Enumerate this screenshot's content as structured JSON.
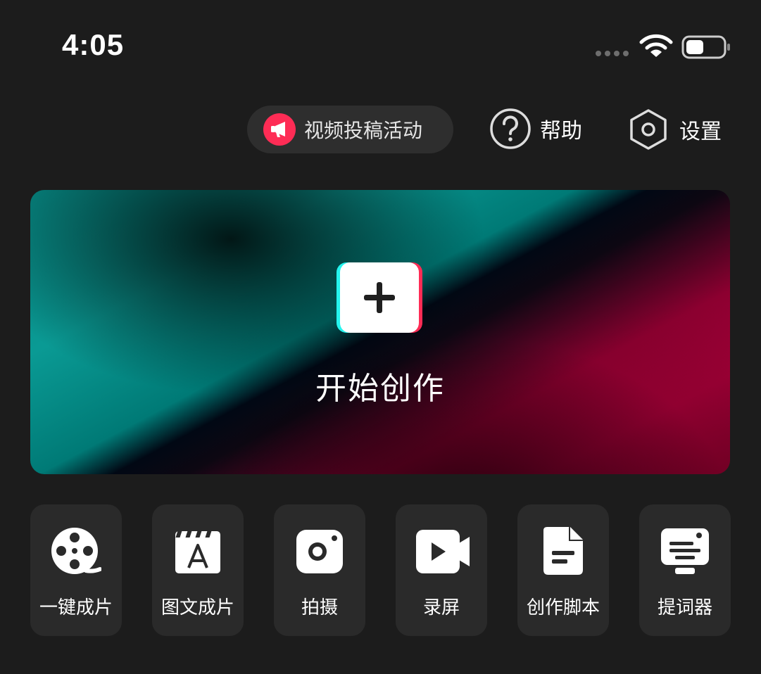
{
  "status_bar": {
    "time": "4:05",
    "wifi_icon": "wifi-icon",
    "battery_icon": "battery-icon"
  },
  "top_actions": {
    "promo": {
      "label": "视频投稿活动",
      "icon": "megaphone-icon",
      "color": "#fe2c55"
    },
    "help": {
      "label": "帮助",
      "icon": "help-circle-icon"
    },
    "settings": {
      "label": "设置",
      "icon": "hexagon-settings-icon"
    }
  },
  "hero": {
    "label": "开始创作",
    "icon": "plus-icon",
    "colors": {
      "teal": "#0a9a94",
      "crimson": "#a7003a",
      "cyan_edge": "#25f4ee",
      "red_edge": "#fe2c55"
    }
  },
  "tools": [
    {
      "label": "一键成片",
      "icon": "film-reel-icon"
    },
    {
      "label": "图文成片",
      "icon": "clapboard-text-icon"
    },
    {
      "label": "拍摄",
      "icon": "camera-icon"
    },
    {
      "label": "录屏",
      "icon": "screen-record-icon"
    },
    {
      "label": "创作脚本",
      "icon": "document-icon"
    },
    {
      "label": "提词器",
      "icon": "teleprompter-icon"
    }
  ]
}
